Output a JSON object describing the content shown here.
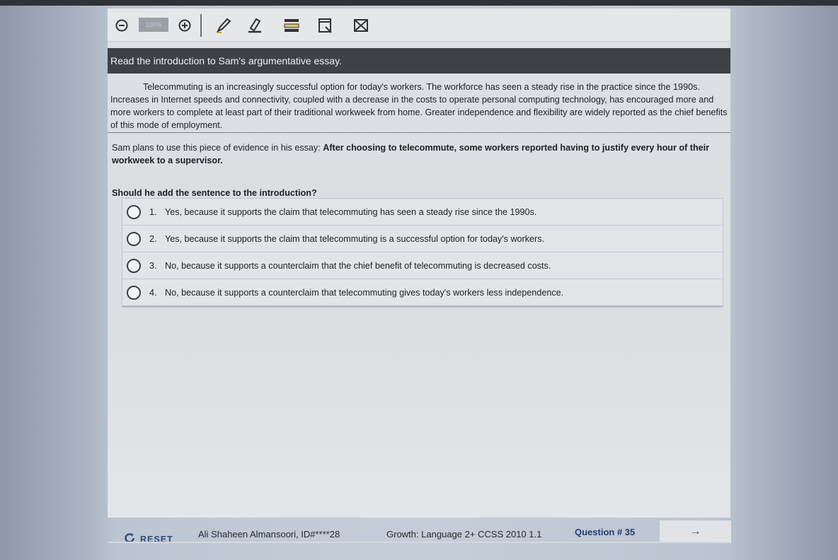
{
  "toolbar": {
    "zoom_value": "100%",
    "icons": [
      "zoom-out-icon",
      "zoom-in-icon",
      "pen-icon",
      "highlighter-icon",
      "line-reader-icon",
      "notepad-icon",
      "answer-eliminator-icon"
    ]
  },
  "instruction": "Read the introduction to Sam's argumentative essay.",
  "passage": "Telecommuting is an increasingly successful option for today's workers. The workforce has seen a steady rise in the practice since the 1990s. Increases in Internet speeds and connectivity, coupled with a decrease in the costs to operate personal computing technology, has encouraged more and more workers to complete at least part of their traditional workweek from home. Greater independence and flexibility are widely reported as the chief benefits of this mode of employment.",
  "evidence": {
    "intro": "Sam plans to use this piece of evidence in his essay: ",
    "quote": "After choosing to telecommute, some workers reported having to justify every hour of their workweek to a supervisor."
  },
  "question": "Should he add the sentence to the introduction?",
  "choices": [
    {
      "number": "1.",
      "text": "Yes, because it supports the claim that telecommuting has seen a steady rise since the 1990s."
    },
    {
      "number": "2.",
      "text": "Yes, because it supports the claim that telecommuting is a successful option for today's workers."
    },
    {
      "number": "3.",
      "text": "No, because it supports a counterclaim that the chief benefit of telecommuting is decreased costs."
    },
    {
      "number": "4.",
      "text": "No, because it supports a counterclaim that telecommuting gives today's workers less independence."
    }
  ],
  "footer": {
    "reset_label": "RESET",
    "student": "Ali Shaheen Almansoori, ID#****28",
    "standard": "Growth: Language 2+ CCSS 2010 1.1",
    "question_number": "Question # 35",
    "next_arrow": "→"
  },
  "colors": {
    "instruction_bar": "#3e4146",
    "link_blue": "#233f73"
  }
}
